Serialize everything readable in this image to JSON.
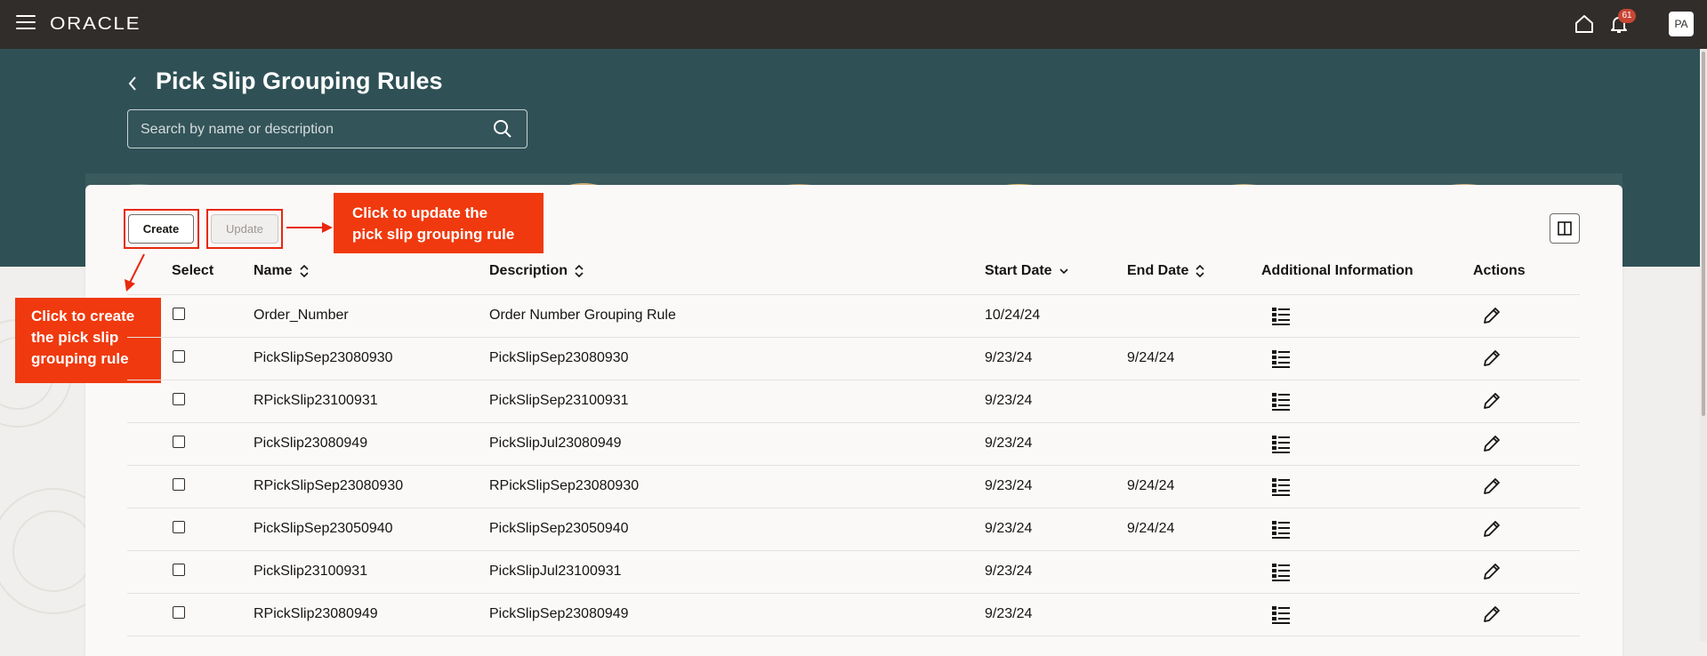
{
  "topbar": {
    "logo": "ORACLE",
    "notification_count": "61",
    "avatar_initials": "PA"
  },
  "header": {
    "title": "Pick Slip Grouping Rules",
    "search_placeholder": "Search by name or description"
  },
  "toolbar": {
    "create_label": "Create",
    "update_label": "Update"
  },
  "callouts": {
    "update": [
      "Click to update the",
      "pick slip grouping rule"
    ],
    "create": [
      "Click to create",
      "the pick slip",
      "grouping rule"
    ]
  },
  "table": {
    "columns": [
      "Select",
      "Name",
      "Description",
      "Start Date",
      "End Date",
      "Additional Information",
      "Actions"
    ],
    "rows": [
      {
        "name": "Order_Number",
        "description": "Order Number Grouping Rule",
        "start": "10/24/24",
        "end": ""
      },
      {
        "name": "PickSlipSep23080930",
        "description": "PickSlipSep23080930",
        "start": "9/23/24",
        "end": "9/24/24"
      },
      {
        "name": "RPickSlip23100931",
        "description": "PickSlipSep23100931",
        "start": "9/23/24",
        "end": ""
      },
      {
        "name": "PickSlip23080949",
        "description": "PickSlipJul23080949",
        "start": "9/23/24",
        "end": ""
      },
      {
        "name": "RPickSlipSep23080930",
        "description": "RPickSlipSep23080930",
        "start": "9/23/24",
        "end": "9/24/24"
      },
      {
        "name": "PickSlipSep23050940",
        "description": "PickSlipSep23050940",
        "start": "9/23/24",
        "end": "9/24/24"
      },
      {
        "name": "PickSlip23100931",
        "description": "PickSlipJul23100931",
        "start": "9/23/24",
        "end": ""
      },
      {
        "name": "RPickSlip23080949",
        "description": "PickSlipSep23080949",
        "start": "9/23/24",
        "end": ""
      }
    ]
  },
  "colors": {
    "topbar": "#312d2a",
    "header": "#2f5156",
    "callout": "#f0390e",
    "highlight_box": "#e8290e"
  }
}
